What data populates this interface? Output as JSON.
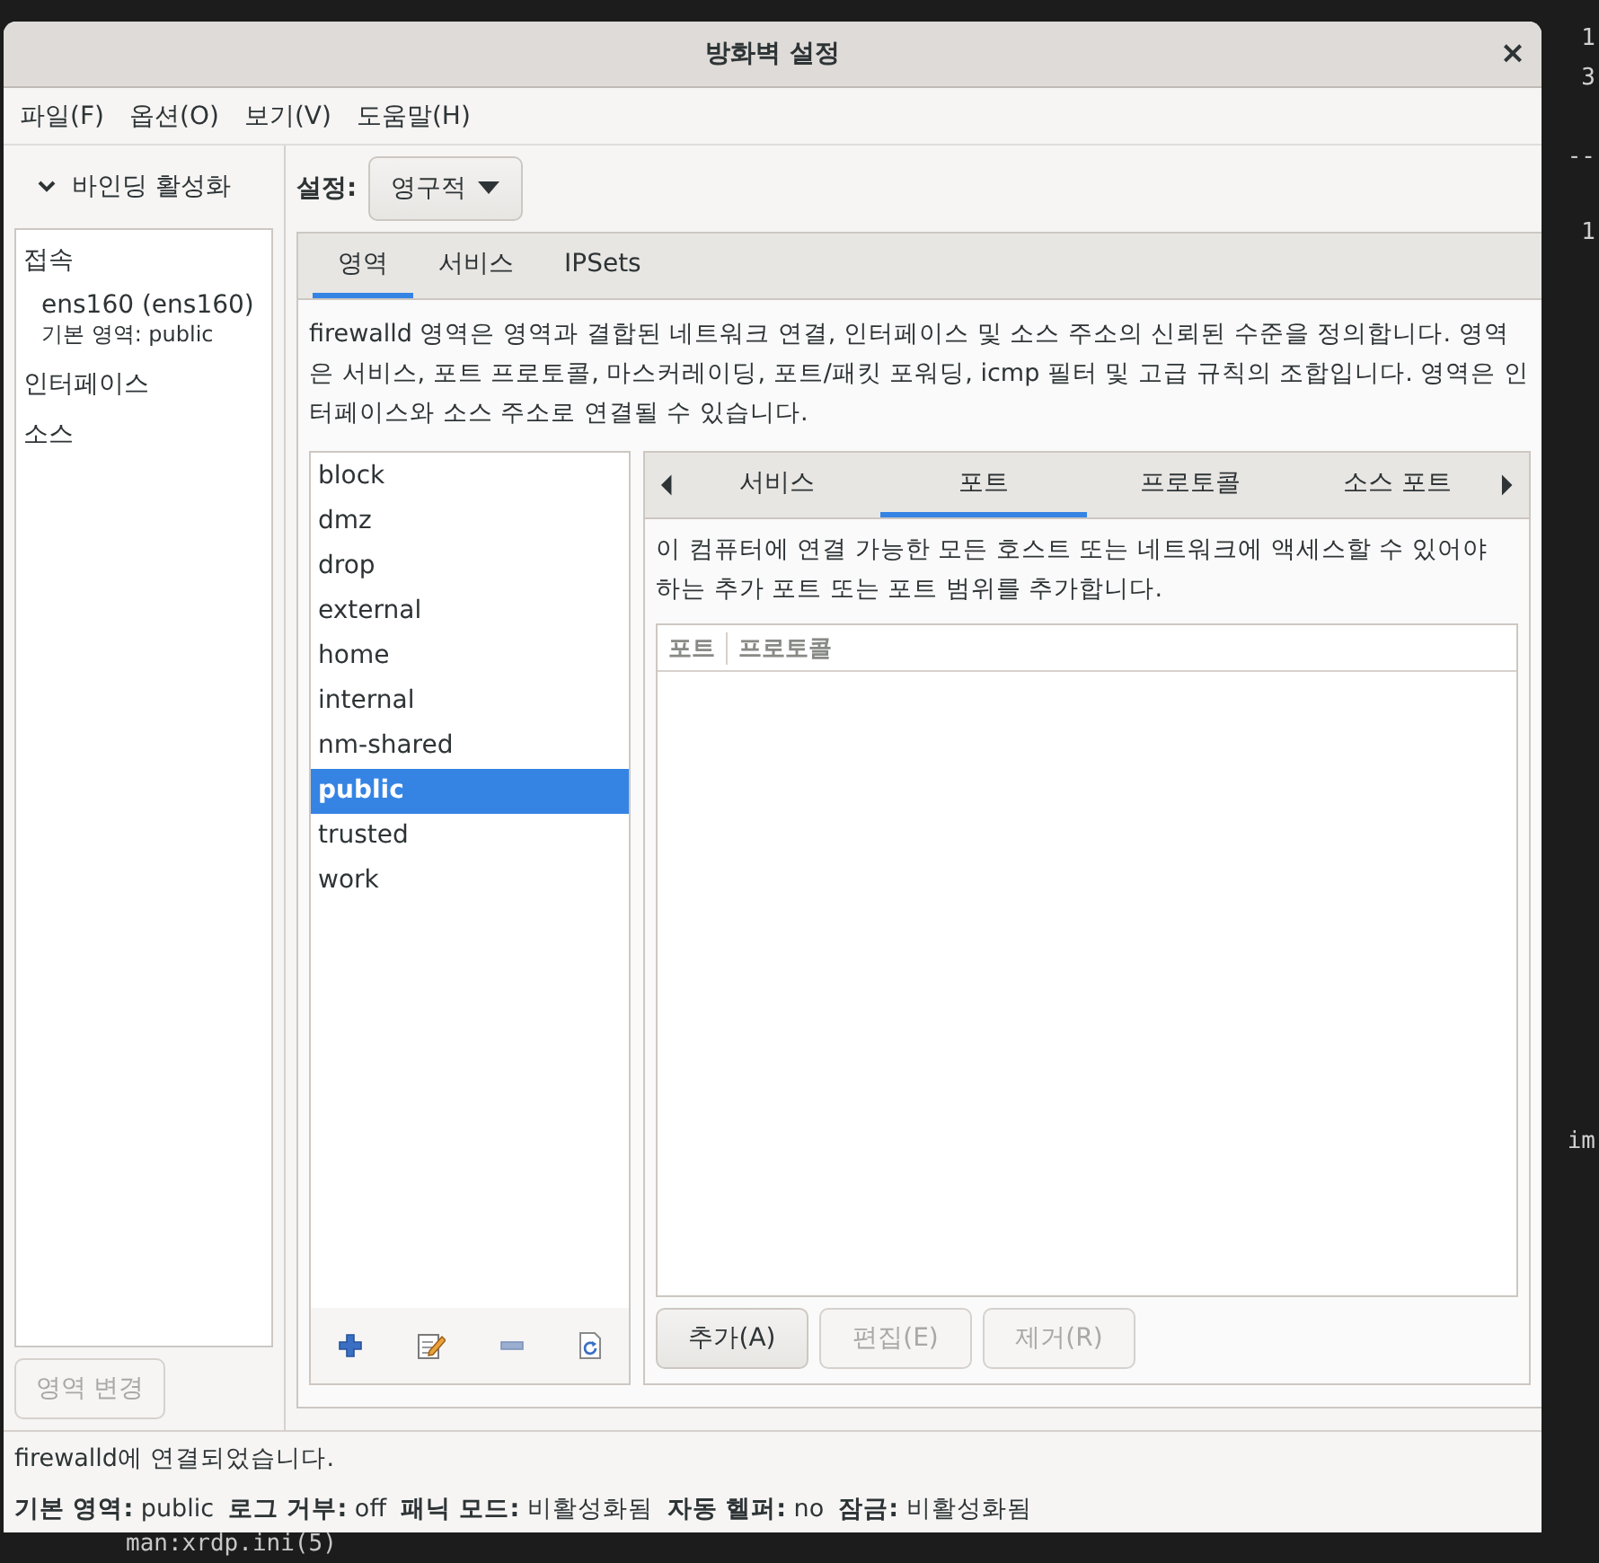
{
  "window": {
    "title": "방화벽 설정",
    "close": "×"
  },
  "menu": [
    "파일(F)",
    "옵션(O)",
    "보기(V)",
    "도움말(H)"
  ],
  "bindings": {
    "header": "바인딩 활성화",
    "expanded": true,
    "groups": [
      {
        "label": "접속",
        "children": [
          {
            "label": "ens160 (ens160)",
            "detail": "기본 영역: public"
          }
        ]
      },
      {
        "label": "인터페이스"
      },
      {
        "label": "소스"
      }
    ]
  },
  "change_zone_button": {
    "label": "영역 변경",
    "disabled": true
  },
  "configuration": {
    "label": "설정:",
    "value": "영구적"
  },
  "tabs": [
    {
      "label": "영역",
      "selected": true
    },
    {
      "label": "서비스",
      "selected": false
    },
    {
      "label": "IPSets",
      "selected": false
    }
  ],
  "zones": {
    "description": "firewalld 영역은 영역과 결합된 네트워크 연결, 인터페이스 및 소스 주소의 신뢰된 수준을 정의합니다. 영역은 서비스, 포트 프로토콜, 마스커레이딩, 포트/패킷 포워딩, icmp 필터 및 고급 규칙의 조합입니다. 영역은 인터페이스와 소스 주소로 연결될 수 있습니다.",
    "items": [
      {
        "label": "block",
        "selected": false
      },
      {
        "label": "dmz",
        "selected": false
      },
      {
        "label": "drop",
        "selected": false
      },
      {
        "label": "external",
        "selected": false
      },
      {
        "label": "home",
        "selected": false
      },
      {
        "label": "internal",
        "selected": false
      },
      {
        "label": "nm-shared",
        "selected": false
      },
      {
        "label": "public",
        "selected": true
      },
      {
        "label": "trusted",
        "selected": false
      },
      {
        "label": "work",
        "selected": false
      }
    ],
    "toolbar": [
      {
        "kind": "add"
      },
      {
        "kind": "edit"
      },
      {
        "kind": "remove"
      },
      {
        "kind": "reload"
      }
    ]
  },
  "zone_tabs": [
    {
      "label": "서비스",
      "selected": false
    },
    {
      "label": "포트",
      "selected": true
    },
    {
      "label": "프로토콜",
      "selected": false
    },
    {
      "label": "소스 포트",
      "selected": false
    }
  ],
  "ports": {
    "description": "이 컴퓨터에 연결 가능한 모든 호스트 또는 네트워크에 액세스할 수 있어야 하는 추가 포트 또는 포트 범위를 추가합니다.",
    "columns": [
      "포트",
      "프로토콜"
    ],
    "buttons": [
      {
        "label": "추가(A)",
        "disabled": false
      },
      {
        "label": "편집(E)",
        "disabled": true
      },
      {
        "label": "제거(R)",
        "disabled": true
      }
    ]
  },
  "status": {
    "message": "firewalld에 연결되었습니다.",
    "fields": [
      {
        "label": "기본 영역:",
        "value": "public"
      },
      {
        "label": "로그 거부:",
        "value": "off"
      },
      {
        "label": "패닉 모드:",
        "value": "비활성화됨"
      },
      {
        "label": "자동 헬퍼:",
        "value": "no"
      },
      {
        "label": "잠금:",
        "value": "비활성화됨"
      }
    ]
  },
  "terminal": {
    "fragments": [
      "1",
      "3",
      "--",
      "1",
      "im"
    ],
    "bottom": "man:xrdp.ini(5)"
  }
}
